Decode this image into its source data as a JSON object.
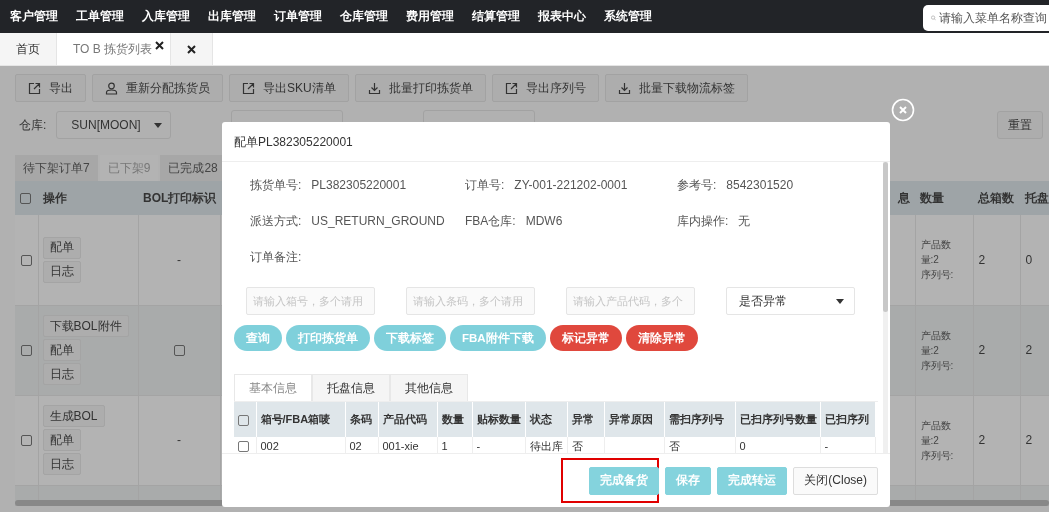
{
  "nav": {
    "items": [
      "客户管理",
      "工单管理",
      "入库管理",
      "出库管理",
      "订单管理",
      "仓库管理",
      "费用管理",
      "结算管理",
      "报表中心",
      "系统管理"
    ],
    "search": {
      "placeholder": "请输入菜单名称查询"
    }
  },
  "page_tabs": [
    {
      "label": "首页",
      "selected": false,
      "closable": false
    },
    {
      "label": "TO B 拣货列表",
      "selected": true,
      "closable": true
    }
  ],
  "close_all_tab": true,
  "toolbar": [
    {
      "label": "导出",
      "kind": "export"
    },
    {
      "label": "重新分配拣货员",
      "kind": "assign"
    },
    {
      "label": "导出SKU清单",
      "kind": "export"
    },
    {
      "label": "批量打印拣货单",
      "kind": "download"
    },
    {
      "label": "导出序列号",
      "kind": "export"
    },
    {
      "label": "批量下载物流标签",
      "kind": "download"
    }
  ],
  "filters": {
    "warehouse_label": "仓库:",
    "warehouse_value": "SUN[MOON]",
    "reset": "重置"
  },
  "status_tabs": [
    {
      "label": "待下架订单7",
      "selected": false
    },
    {
      "label": "已下架9",
      "selected": true
    },
    {
      "label": "已完成28",
      "selected": false
    }
  ],
  "table": {
    "all_checked": false,
    "columns": [
      "操作",
      "BOL打印标识"
    ],
    "right_columns": [
      "息",
      "数量",
      "总箱数",
      "托盘"
    ],
    "rows": [
      {
        "checked": false,
        "actions": [
          "配单",
          "日志"
        ],
        "bol": {
          "kind": "text",
          "text": "-"
        },
        "qty": [
          "产品数量:2",
          "序列号:"
        ],
        "boxes": "2",
        "pallets": "0"
      },
      {
        "checked": false,
        "actions": [
          "下载BOL附件",
          "配单",
          "日志"
        ],
        "bol": {
          "kind": "checkbox",
          "checked": false
        },
        "qty": [
          "产品数量:2",
          "序列号:"
        ],
        "boxes": "2",
        "pallets": "2"
      },
      {
        "checked": false,
        "actions": [
          "生成BOL",
          "配单",
          "日志"
        ],
        "bol": {
          "kind": "text",
          "text": "-"
        },
        "qty": [
          "产品数量:2",
          "序列号:"
        ],
        "boxes": "2",
        "pallets": "2"
      }
    ]
  },
  "modal": {
    "title": "配单PL382305220001",
    "fields": [
      {
        "label": "拣货单号:",
        "value": "PL382305220001"
      },
      {
        "label": "订单号:",
        "value": "ZY-001-221202-0001"
      },
      {
        "label": "参考号:",
        "value": "8542301520"
      },
      {
        "label": "派送方式:",
        "value": "US_RETURN_GROUND"
      },
      {
        "label": "FBA仓库:",
        "value": "MDW6"
      },
      {
        "label": "库内操作:",
        "value": "无"
      },
      {
        "label": "订单备注:"
      }
    ],
    "search_inputs": [
      {
        "placeholder": "请输入箱号，多个请用"
      },
      {
        "placeholder": "请输入条码，多个请用"
      },
      {
        "placeholder": "请输入产品代码，多个"
      }
    ],
    "exception_select": "是否异常",
    "actions": [
      {
        "label": "查询",
        "kind": "primary"
      },
      {
        "label": "打印拣货单",
        "kind": "primary"
      },
      {
        "label": "下载标签",
        "kind": "primary"
      },
      {
        "label": "FBA附件下载",
        "kind": "primary"
      },
      {
        "label": "标记异常",
        "kind": "danger"
      },
      {
        "label": "清除异常",
        "kind": "danger"
      }
    ],
    "tabs": [
      {
        "label": "基本信息",
        "selected": true
      },
      {
        "label": "托盘信息",
        "selected": false
      },
      {
        "label": "其他信息",
        "selected": false
      }
    ],
    "all_checked": false,
    "columns": [
      "箱号/FBA箱唛",
      "条码",
      "产品代码",
      "数量",
      "贴标数量",
      "状态",
      "异常",
      "异常原因",
      "需扫序列号",
      "已扫序列号数量",
      "已扫序列"
    ],
    "rows": [
      {
        "checked": false,
        "cells": [
          "002",
          "02",
          "001-xie",
          "1",
          "-",
          "待出库",
          "否",
          null,
          "否",
          "0",
          "-"
        ]
      }
    ],
    "footer": [
      {
        "label": "完成备货",
        "kind": "primary",
        "highlighted": true
      },
      {
        "label": "保存",
        "kind": "primary",
        "highlighted": false
      },
      {
        "label": "完成转运",
        "kind": "primary",
        "highlighted": false
      },
      {
        "label": "关闭(Close)",
        "kind": "default",
        "highlighted": false
      }
    ]
  }
}
